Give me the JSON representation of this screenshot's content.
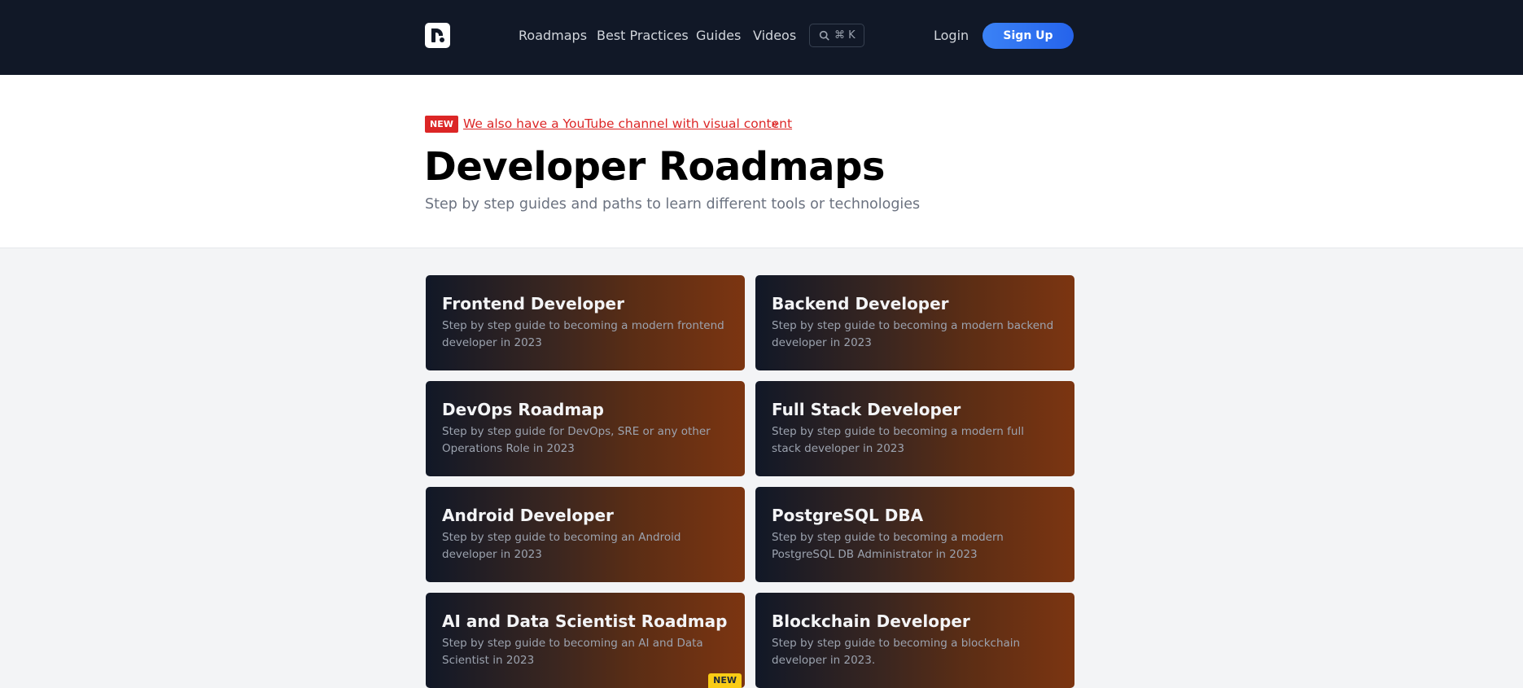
{
  "header": {
    "nav": [
      "Roadmaps",
      "Best Practices",
      "Guides",
      "Videos"
    ],
    "search_shortcut": "⌘ K",
    "login": "Login",
    "signup": "Sign Up"
  },
  "announcement": {
    "badge": "NEW",
    "link_text": "We also have a YouTube channel with visual content",
    "suffix": "»"
  },
  "hero": {
    "title": "Developer Roadmaps",
    "subtitle": "Step by step guides and paths to learn different tools or technologies"
  },
  "roadmaps": [
    {
      "title": "Frontend Developer",
      "desc": "Step by step guide to becoming a modern frontend developer in 2023"
    },
    {
      "title": "Backend Developer",
      "desc": "Step by step guide to becoming a modern backend developer in 2023"
    },
    {
      "title": "DevOps Roadmap",
      "desc": "Step by step guide for DevOps, SRE or any other Operations Role in 2023"
    },
    {
      "title": "Full Stack Developer",
      "desc": "Step by step guide to becoming a modern full stack developer in 2023"
    },
    {
      "title": "Android Developer",
      "desc": "Step by step guide to becoming an Android developer in 2023"
    },
    {
      "title": "PostgreSQL DBA",
      "desc": "Step by step guide to becoming a modern PostgreSQL DB Administrator in 2023"
    },
    {
      "title": "AI and Data Scientist Roadmap",
      "desc": "Step by step guide to becoming an AI and Data Scientist in 2023",
      "badge": "NEW"
    },
    {
      "title": "Blockchain Developer",
      "desc": "Step by step guide to becoming a blockchain developer in 2023."
    }
  ],
  "colors": {
    "header_bg": "#111827",
    "accent_red": "#dc2626",
    "signup_blue": "#2563eb",
    "card_gradient_start": "#111827",
    "card_gradient_end": "#7c3511",
    "badge_yellow": "#facc15"
  }
}
